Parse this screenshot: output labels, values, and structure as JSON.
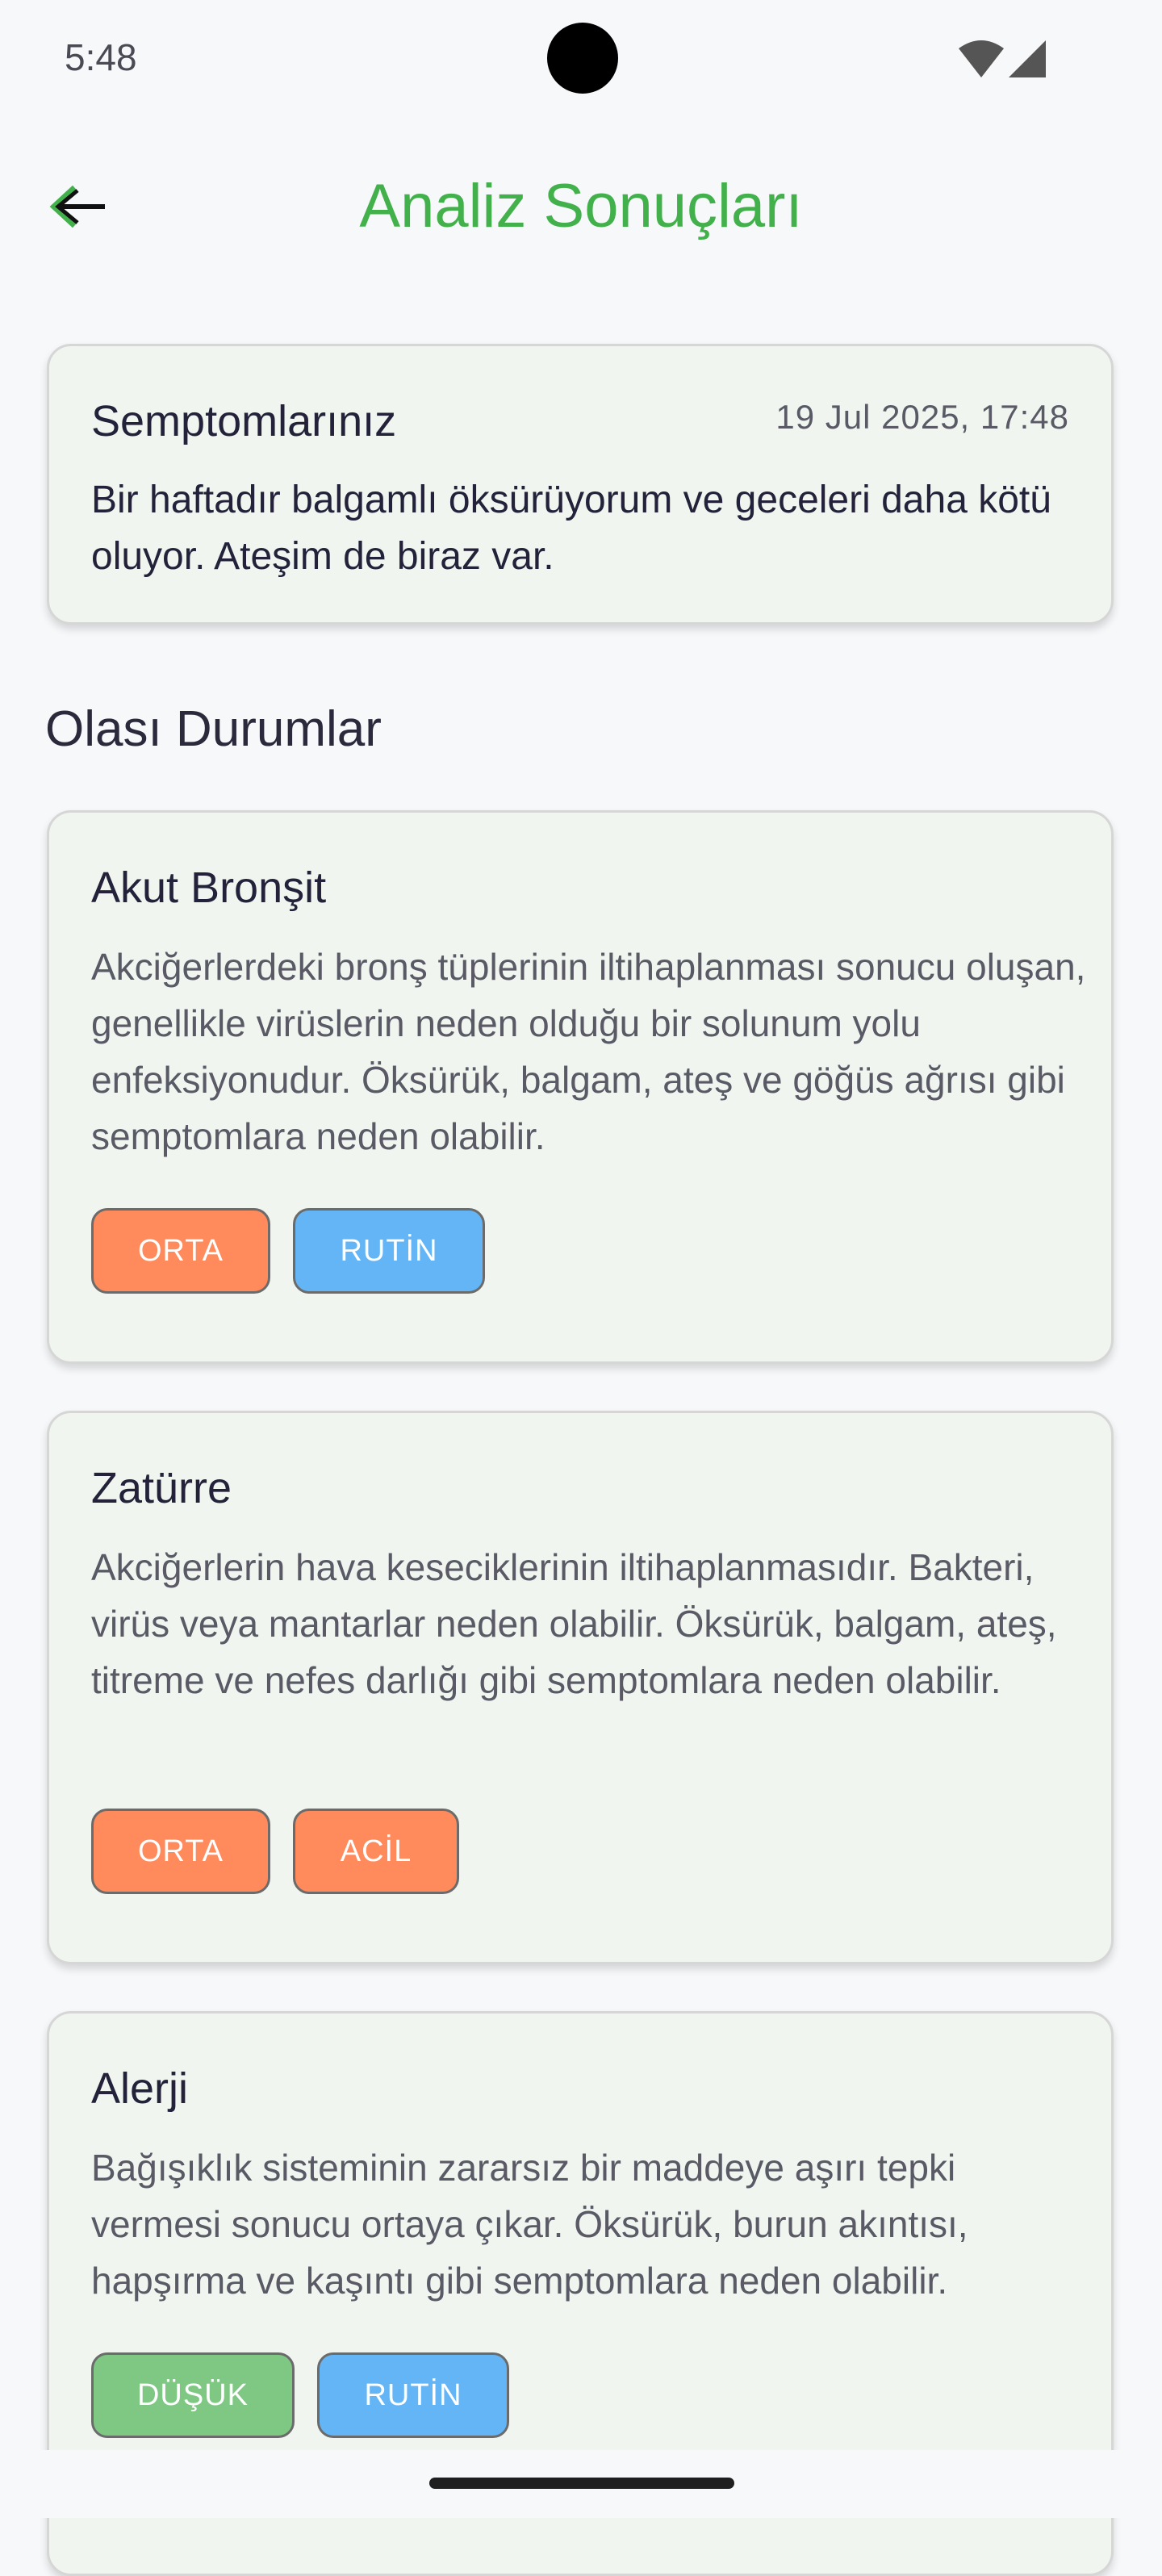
{
  "status_bar": {
    "time": "5:48"
  },
  "app_bar": {
    "title": "Analiz Sonuçları"
  },
  "symptoms": {
    "title": "Semptomlarınız",
    "date": "19 Jul 2025, 17:48",
    "text": "Bir haftadır balgamlı öksürüyorum ve geceleri daha kötü oluyor. Ateşim de biraz var."
  },
  "section": {
    "title": "Olası Durumlar"
  },
  "conditions": [
    {
      "title": "Akut Bronşit",
      "description": "Akciğerlerdeki bronş tüplerinin iltihaplanması sonucu oluşan, genellikle virüslerin neden olduğu bir solunum yolu enfeksiyonudur. Öksürük, balgam, ateş ve göğüs ağrısı gibi semptomlara neden olabilir.",
      "tags": [
        "ORTA",
        "RUTİN"
      ]
    },
    {
      "title": "Zatürre",
      "description": "Akciğerlerin hava keseciklerinin iltihaplanmasıdır. Bakteri, virüs veya mantarlar neden olabilir. Öksürük, balgam, ateş, titreme ve nefes darlığı gibi semptomlara neden olabilir.",
      "tags": [
        "ORTA",
        "ACİL"
      ]
    },
    {
      "title": "Alerji",
      "description": "Bağışıklık sisteminin zararsız bir maddeye aşırı tepki vermesi sonucu ortaya çıkar. Öksürük, burun akıntısı, hapşırma ve kaşıntı gibi semptomlara neden olabilir.",
      "tags": [
        "DÜŞÜK",
        "RUTİN"
      ]
    }
  ],
  "colors": {
    "title_green": "#43b14b",
    "card_bg": "#f0f6ef",
    "tag_orange": "#ff8a5c",
    "tag_blue": "#64b5f6",
    "tag_green": "#7ec884"
  },
  "icons": [
    "wifi-icon",
    "signal-icon",
    "back-arrow-icon"
  ]
}
